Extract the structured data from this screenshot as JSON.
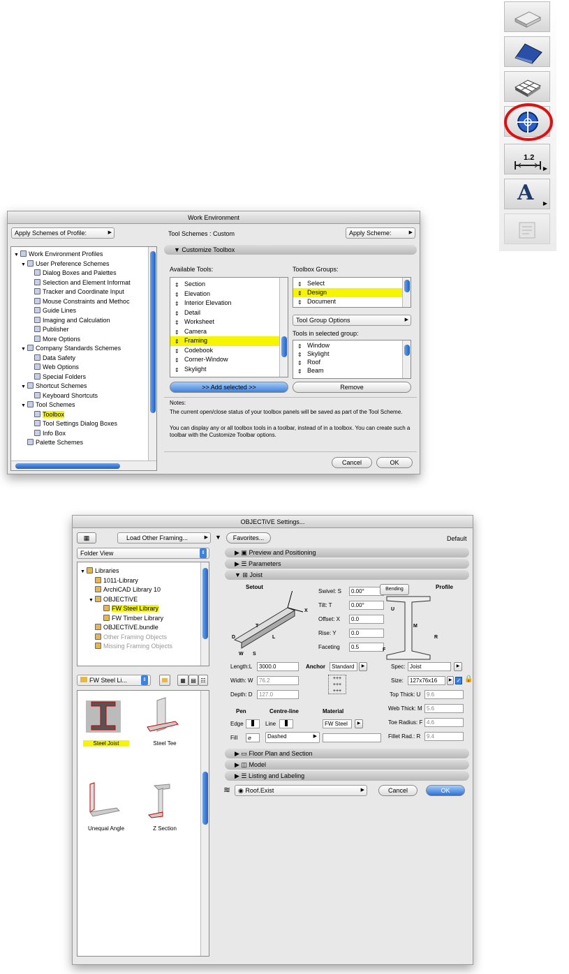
{
  "palette": {
    "tools": [
      {
        "icon": "slab-icon"
      },
      {
        "icon": "roof-icon"
      },
      {
        "icon": "mesh-icon"
      },
      {
        "icon": "objective-target-icon",
        "highlighted": true
      },
      {
        "icon": "dimension-icon",
        "label": "1.2"
      },
      {
        "icon": "text-icon",
        "label": "A"
      },
      {
        "icon": "label-icon"
      }
    ],
    "highlight_color": "#e01010"
  },
  "we": {
    "title": "Work Environment",
    "apply_profile": "Apply Schemes of Profile:",
    "tool_schemes": "Tool Schemes : Custom",
    "apply_scheme": "Apply Scheme:",
    "tree": [
      {
        "label": "Work Environment Profiles",
        "level": 0,
        "open": true
      },
      {
        "label": "User Preference Schemes",
        "level": 1,
        "open": true
      },
      {
        "label": "Dialog Boxes and Palettes",
        "level": 2
      },
      {
        "label": "Selection and Element Informat",
        "level": 2
      },
      {
        "label": "Tracker and Coordinate Input",
        "level": 2
      },
      {
        "label": "Mouse Constraints and Methoc",
        "level": 2
      },
      {
        "label": "Guide Lines",
        "level": 2
      },
      {
        "label": "Imaging and Calculation",
        "level": 2
      },
      {
        "label": "Publisher",
        "level": 2
      },
      {
        "label": "More Options",
        "level": 2
      },
      {
        "label": "Company Standards Schemes",
        "level": 1,
        "open": true
      },
      {
        "label": "Data Safety",
        "level": 2
      },
      {
        "label": "Web Options",
        "level": 2
      },
      {
        "label": "Special Folders",
        "level": 2
      },
      {
        "label": "Shortcut Schemes",
        "level": 1,
        "open": true
      },
      {
        "label": "Keyboard Shortcuts",
        "level": 2
      },
      {
        "label": "Tool Schemes",
        "level": 1,
        "open": true
      },
      {
        "label": "Toolbox",
        "level": 2,
        "selected": true
      },
      {
        "label": "Tool Settings Dialog Boxes",
        "level": 2
      },
      {
        "label": "Info Box",
        "level": 2
      },
      {
        "label": "Palette Schemes",
        "level": 1
      }
    ],
    "section": "Customize Toolbox",
    "available_label": "Available Tools:",
    "available": [
      "Section",
      "Elevation",
      "Interior Elevation",
      "Detail",
      "Worksheet",
      "Camera",
      "Framing",
      "Codebook",
      "Corner-Window",
      "Skylight"
    ],
    "available_selected": "Framing",
    "groups_label": "Toolbox Groups:",
    "groups": [
      "Select",
      "Design",
      "Document"
    ],
    "groups_selected": "Design",
    "group_options": "Tool Group Options",
    "in_group_label": "Tools in selected group:",
    "in_group": [
      "Window",
      "Skylight",
      "Roof",
      "Beam"
    ],
    "add_btn": ">> Add selected >>",
    "remove_btn": "Remove",
    "notes_label": "Notes:",
    "note1": "The current open/close status of your toolbox panels will be saved as part of the Tool Scheme.",
    "note2": "You can display any or all toolbox tools in a toolbar, instead of in a toolbox. You can create such a toolbar with the Customize Toolbar options.",
    "cancel": "Cancel",
    "ok": "OK"
  },
  "obj": {
    "title": "OBJECTiVE Settings...",
    "load_other": "Load Other Framing...",
    "favorites": "Favorites...",
    "default": "Default",
    "folder_view": "Folder View",
    "tree": [
      {
        "label": "Libraries",
        "level": 0,
        "open": true
      },
      {
        "label": "1011-Library",
        "level": 1
      },
      {
        "label": "ArchiCAD Library 10",
        "level": 1
      },
      {
        "label": "OBJECTiVE",
        "level": 1,
        "open": true
      },
      {
        "label": "FW Steel Library",
        "level": 2,
        "selected": true
      },
      {
        "label": "FW Timber Library",
        "level": 2
      },
      {
        "label": "OBJECTiVE.bundle",
        "level": 1
      },
      {
        "label": "Other Framing Objects",
        "level": 1,
        "dim": true
      },
      {
        "label": "Missing Framing Objects",
        "level": 1,
        "dim": true
      }
    ],
    "lib_select": "FW Steel Li...",
    "gallery": [
      {
        "label": "Steel Joist",
        "selected": true
      },
      {
        "label": "Steel Tee"
      },
      {
        "label": "Unequal Angle"
      },
      {
        "label": "Z Section"
      }
    ],
    "sections": {
      "preview": "Preview and Positioning",
      "params": "Parameters",
      "joist": "Joist",
      "floor": "Floor Plan and Section",
      "model": "Model",
      "listing": "Listing and Labeling"
    },
    "setout": "Setout",
    "bending": "Bending",
    "profile": "Profile",
    "swivel_l": "Swivel: S",
    "swivel": "0.00°",
    "tilt_l": "Tilt:   T",
    "tilt": "0.00°",
    "offset_l": "Offset: X",
    "offset": "0.0",
    "rise_l": "Rise:   Y",
    "rise": "0.0",
    "faceting_l": "Faceting",
    "faceting": "0.5",
    "length_l": "Length:L",
    "length": "3000.0",
    "width_l": "Width: W",
    "width": "76.2",
    "depth_l": "Depth: D",
    "depth": "127.0",
    "anchor_l": "Anchor",
    "anchor": "Standard",
    "spec_l": "Spec:",
    "spec": "Joist",
    "size_l": "Size:",
    "size": "127x76x16",
    "top_l": "Top Thick: U",
    "top": "9.6",
    "web_l": "Web Thick: M",
    "web": "5.6",
    "toe_l": "Toe Radius: F",
    "toe": "4.6",
    "fillet_l": "Fillet Rad.: R",
    "fillet": "9.4",
    "pen_l": "Pen",
    "centre_l": "Centre-line",
    "material_l": "Material",
    "edge_l": "Edge",
    "line_l": "Line",
    "material": "FW Steel",
    "fill_l": "Fill",
    "dashed": "Dashed",
    "diag": {
      "y": "Y",
      "x": "X",
      "t": "T",
      "d": "D",
      "w": "W",
      "s": "S",
      "l": "L",
      "u": "U",
      "m": "M",
      "r": "R",
      "f": "F"
    },
    "layer": "Roof.Exist",
    "cancel": "Cancel",
    "ok": "OK"
  }
}
